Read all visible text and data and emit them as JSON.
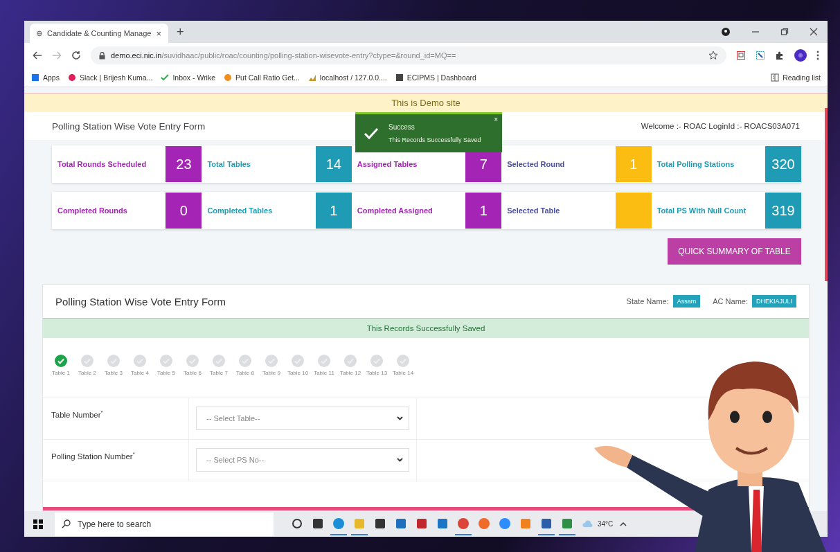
{
  "browser": {
    "tab_title": "Candidate & Counting Manage",
    "tab_close": "×",
    "new_tab": "+",
    "url_host": "demo.eci.nic.in",
    "url_path": "/suvidhaac/public/roac/counting/polling-station-wisevote-entry?ctype=&round_id=MQ==",
    "bookmarks": [
      "Apps",
      "Slack | Brijesh Kuma...",
      "Inbox - Wrike",
      "Put Call Ratio Get...",
      "localhost / 127.0.0....",
      "ECIPMS | Dashboard"
    ],
    "reading_list": "Reading list"
  },
  "demo_banner": "This is Demo site",
  "toast": {
    "title": "Success",
    "message": "This Records Successfully Saved",
    "close": "×"
  },
  "header": {
    "title": "Polling Station Wise Vote Entry Form",
    "welcome": "Welcome :- ROAC LoginId :- ROACS03A071"
  },
  "stats": [
    [
      {
        "label": "Total Rounds Scheduled",
        "value": "23",
        "color": "#a324b5"
      },
      {
        "label": "Total Tables",
        "value": "14",
        "color": "#1f9bb5"
      },
      {
        "label": "Assigned Tables",
        "value": "7",
        "color": "#a324b5"
      },
      {
        "label": "Selected Round",
        "value": "1",
        "color": "#fbbd12"
      },
      {
        "label": "Total Polling Stations",
        "value": "320",
        "color": "#1f9bb5"
      }
    ],
    [
      {
        "label": "Completed Rounds",
        "value": "0",
        "color": "#a324b5"
      },
      {
        "label": "Completed Tables",
        "value": "1",
        "color": "#1f9bb5"
      },
      {
        "label": "Completed Assigned",
        "value": "1",
        "color": "#a324b5"
      },
      {
        "label": "Selected Table",
        "color": "#fbbd12"
      },
      {
        "label": "Total PS With Null Count",
        "value": "319",
        "color": "#1f9bb5"
      }
    ]
  ],
  "summary_button": "QUICK SUMMARY OF TABLE",
  "form": {
    "title": "Polling Station Wise Vote Entry Form",
    "state_label": "State Name:",
    "state_value": "Assam",
    "ac_label": "AC Name:",
    "ac_value": "DHEKIAJULI",
    "alert": "This Records Successfully Saved",
    "steps": [
      {
        "label": "Table 1",
        "done": true
      },
      {
        "label": "Table 2",
        "done": false
      },
      {
        "label": "Table 3",
        "done": false
      },
      {
        "label": "Table 4",
        "done": false
      },
      {
        "label": "Table 5",
        "done": false
      },
      {
        "label": "Table 6",
        "done": false
      },
      {
        "label": "Table 7",
        "done": false
      },
      {
        "label": "Table 8",
        "done": false
      },
      {
        "label": "Table 9",
        "done": false
      },
      {
        "label": "Table 10",
        "done": false
      },
      {
        "label": "Table 11",
        "done": false
      },
      {
        "label": "Table 12",
        "done": false
      },
      {
        "label": "Table 13",
        "done": false
      },
      {
        "label": "Table 14",
        "done": false
      }
    ],
    "fields": [
      {
        "label": "Table Number",
        "required": "*",
        "placeholder": "-- Select Table--"
      },
      {
        "label": "Polling Station Number",
        "required": "*",
        "placeholder": "-- Select PS No--"
      }
    ]
  },
  "taskbar": {
    "search_placeholder": "Type here to search",
    "weather": "34°C",
    "apps": [
      {
        "active": false
      },
      {
        "active": false
      },
      {
        "active": true
      },
      {
        "active": true
      },
      {
        "active": false
      },
      {
        "active": false
      },
      {
        "active": false
      },
      {
        "active": false
      },
      {
        "active": true
      },
      {
        "active": false
      },
      {
        "active": false
      },
      {
        "active": false
      },
      {
        "active": true
      },
      {
        "active": true
      }
    ]
  }
}
